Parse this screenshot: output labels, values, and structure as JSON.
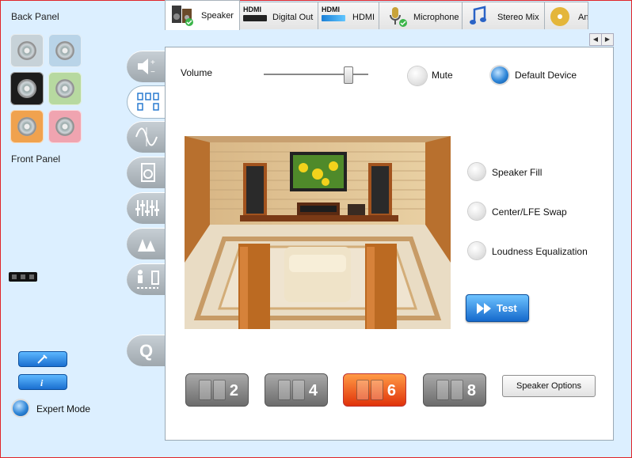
{
  "left": {
    "back_panel_label": "Back Panel",
    "front_panel_label": "Front Panel",
    "expert_mode_label": "Expert Mode"
  },
  "tabs": [
    {
      "label": "Speaker"
    },
    {
      "label": "Digital Out",
      "badge": "HDMI"
    },
    {
      "label": "HDMI",
      "badge": "HDMI"
    },
    {
      "label": "Microphone"
    },
    {
      "label": "Stereo Mix"
    },
    {
      "label": "An"
    }
  ],
  "main": {
    "volume_label": "Volume",
    "volume_level": 0.8,
    "mute_label": "Mute",
    "default_device_label": "Default Device",
    "options": [
      {
        "label": "Speaker Fill"
      },
      {
        "label": "Center/LFE Swap"
      },
      {
        "label": "Loudness Equalization"
      }
    ],
    "test_label": "Test",
    "speaker_configs": [
      "2",
      "4",
      "6",
      "8"
    ],
    "selected_config": "6",
    "speaker_options_label": "Speaker Options"
  },
  "colors": {
    "accent_blue": "#2f86d8",
    "selected_orange": "#e0320a",
    "frame_red": "#e0242a"
  }
}
